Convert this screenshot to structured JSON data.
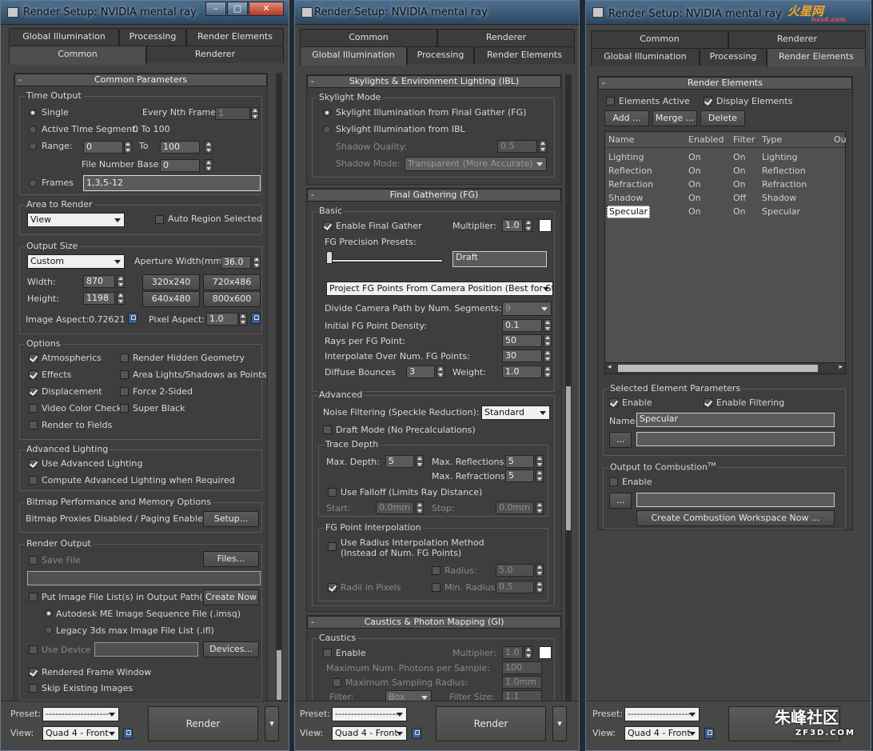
{
  "window_title": "Render Setup: NVIDIA mental ray",
  "tabs": {
    "global_illumination": "Global Illumination",
    "processing": "Processing",
    "render_elements": "Render Elements",
    "common": "Common",
    "renderer": "Renderer"
  },
  "w1": {
    "rollout": "Common Parameters",
    "time_output": {
      "label": "Time Output",
      "single": "Single",
      "every_nth": "Every Nth Frame:",
      "every_nth_val": "1",
      "active_segment": "Active Time Segment:",
      "active_val": "0 To 100",
      "range": "Range:",
      "range_from": "0",
      "to": "To",
      "range_to": "100",
      "file_base": "File Number Base:",
      "file_base_val": "0",
      "frames": "Frames",
      "frames_val": "1,3,5-12"
    },
    "area": {
      "label": "Area to Render",
      "value": "View",
      "auto_region": "Auto Region Selected"
    },
    "output_size": {
      "label": "Output Size",
      "preset": "Custom",
      "aperture": "Aperture Width(mm):",
      "aperture_val": "36.0",
      "width": "Width:",
      "width_val": "870",
      "height": "Height:",
      "height_val": "1198",
      "p1": "320x240",
      "p2": "720x486",
      "p3": "640x480",
      "p4": "800x600",
      "image_aspect": "Image Aspect:0.72621",
      "pixel_aspect": "Pixel Aspect:",
      "pixel_aspect_val": "1.0"
    },
    "options": {
      "label": "Options",
      "atmospherics": "Atmospherics",
      "hidden": "Render Hidden Geometry",
      "effects": "Effects",
      "area_lights": "Area Lights/Shadows as Points",
      "displacement": "Displacement",
      "force2": "Force 2-Sided",
      "video_color": "Video Color Check",
      "super_black": "Super Black",
      "render_fields": "Render to Fields"
    },
    "adv_light": {
      "label": "Advanced Lighting",
      "use": "Use Advanced Lighting",
      "compute": "Compute Advanced Lighting when Required"
    },
    "bitmap": {
      "label": "Bitmap Performance and Memory Options",
      "status": "Bitmap Proxies Disabled / Paging Enabled",
      "setup": "Setup..."
    },
    "render_output": {
      "label": "Render Output",
      "save_file": "Save File",
      "files": "Files...",
      "put_list": "Put Image File List(s) in Output Path(s)",
      "create_now": "Create Now",
      "autodesk": "Autodesk ME Image Sequence File (.imsq)",
      "legacy": "Legacy 3ds max Image File List (.ifl)",
      "use_device": "Use Device",
      "devices": "Devices...",
      "rfw": "Rendered Frame Window",
      "skip": "Skip Existing Images"
    }
  },
  "w2": {
    "skylight": {
      "head": "Skylights & Environment Lighting (IBL)",
      "label": "Skylight Mode",
      "fg": "Skylight Illumination from Final Gather (FG)",
      "ibl": "Skylight Illumination from IBL",
      "shadow_quality": "Shadow Quality:",
      "shadow_quality_val": "0.5",
      "shadow_mode": "Shadow Mode:",
      "shadow_mode_val": "Transparent (More Accurate)"
    },
    "fg": {
      "head": "Final Gathering (FG)",
      "basic": "Basic",
      "enable": "Enable Final Gather",
      "multiplier": "Multiplier:",
      "multiplier_val": "1.0",
      "precision": "FG Precision Presets:",
      "preset_val": "Draft",
      "project": "Project FG Points From Camera Position (Best for Stills)",
      "divide": "Divide Camera Path by Num. Segments:",
      "divide_val": "9",
      "initial": "Initial FG Point Density:",
      "initial_val": "0.1",
      "rays": "Rays per FG Point:",
      "rays_val": "50",
      "interp": "Interpolate Over Num. FG Points:",
      "interp_val": "30",
      "diffuse": "Diffuse Bounces",
      "diffuse_val": "3",
      "weight": "Weight:",
      "weight_val": "1.0"
    },
    "advanced": {
      "label": "Advanced",
      "noise": "Noise Filtering (Speckle Reduction):",
      "noise_val": "Standard",
      "draft": "Draft Mode (No Precalculations)",
      "trace": "Trace Depth",
      "max_depth": "Max. Depth:",
      "max_depth_val": "5",
      "max_refl": "Max. Reflections:",
      "max_refl_val": "5",
      "max_refr": "Max. Refractions:",
      "max_refr_val": "5",
      "falloff": "Use Falloff (Limits Ray Distance)",
      "start": "Start:",
      "start_val": "0.0mm",
      "stop": "Stop:",
      "stop_val": "0.0mm",
      "fgpi": "FG Point Interpolation",
      "use_radius": "Use Radius Interpolation Method",
      "use_radius2": "(Instead of Num. FG Points)",
      "radius": "Radius:",
      "radius_val": "5.0",
      "radii_px": "Radii in Pixels",
      "min_radius": "Min. Radius:",
      "min_radius_val": "0.5"
    },
    "caustics": {
      "head": "Caustics & Photon Mapping (GI)",
      "label": "Caustics",
      "enable": "Enable",
      "multiplier": "Multiplier:",
      "multiplier_val": "1.0",
      "max_photons": "Maximum Num. Photons per Sample:",
      "max_photons_val": "100",
      "max_radius": "Maximum Sampling Radius:",
      "max_radius_val": "1.0mm",
      "filter": "Filter:",
      "filter_val": "Box",
      "filter_size": "Filter Size:",
      "filter_size_val": "1.1"
    }
  },
  "w3": {
    "head": "Render Elements",
    "elements_active": "Elements Active",
    "display_elements": "Display Elements",
    "add": "Add ...",
    "merge": "Merge ...",
    "delete": "Delete",
    "cols": [
      "Name",
      "Enabled",
      "Filter",
      "Type",
      "Ou"
    ],
    "rows": [
      {
        "name": "Lighting",
        "enabled": "On",
        "filter": "On",
        "type": "Lighting"
      },
      {
        "name": "Reflection",
        "enabled": "On",
        "filter": "On",
        "type": "Reflection"
      },
      {
        "name": "Refraction",
        "enabled": "On",
        "filter": "On",
        "type": "Refraction"
      },
      {
        "name": "Shadow",
        "enabled": "On",
        "filter": "Off",
        "type": "Shadow"
      },
      {
        "name": "Specular",
        "enabled": "On",
        "filter": "On",
        "type": "Specular"
      }
    ],
    "sel": {
      "label": "Selected Element Parameters",
      "enable": "Enable",
      "enable_filtering": "Enable Filtering",
      "name": "Name:",
      "name_val": "Specular",
      "browse": "..."
    },
    "comb": {
      "label": "Output to Combustion",
      "tm": "TM",
      "enable": "Enable",
      "browse": "...",
      "create": "Create Combustion Workspace Now ..."
    }
  },
  "bottom": {
    "preset": "Preset:",
    "preset_val": "--------------------",
    "view": "View:",
    "view_val": "Quad 4 - Front",
    "render": "Render"
  },
  "watermarks": {
    "top": "火星网",
    "top_sub": "hxsd.com",
    "bottom": "朱峰社区",
    "bottom_sub": "ZF3D.COM"
  }
}
